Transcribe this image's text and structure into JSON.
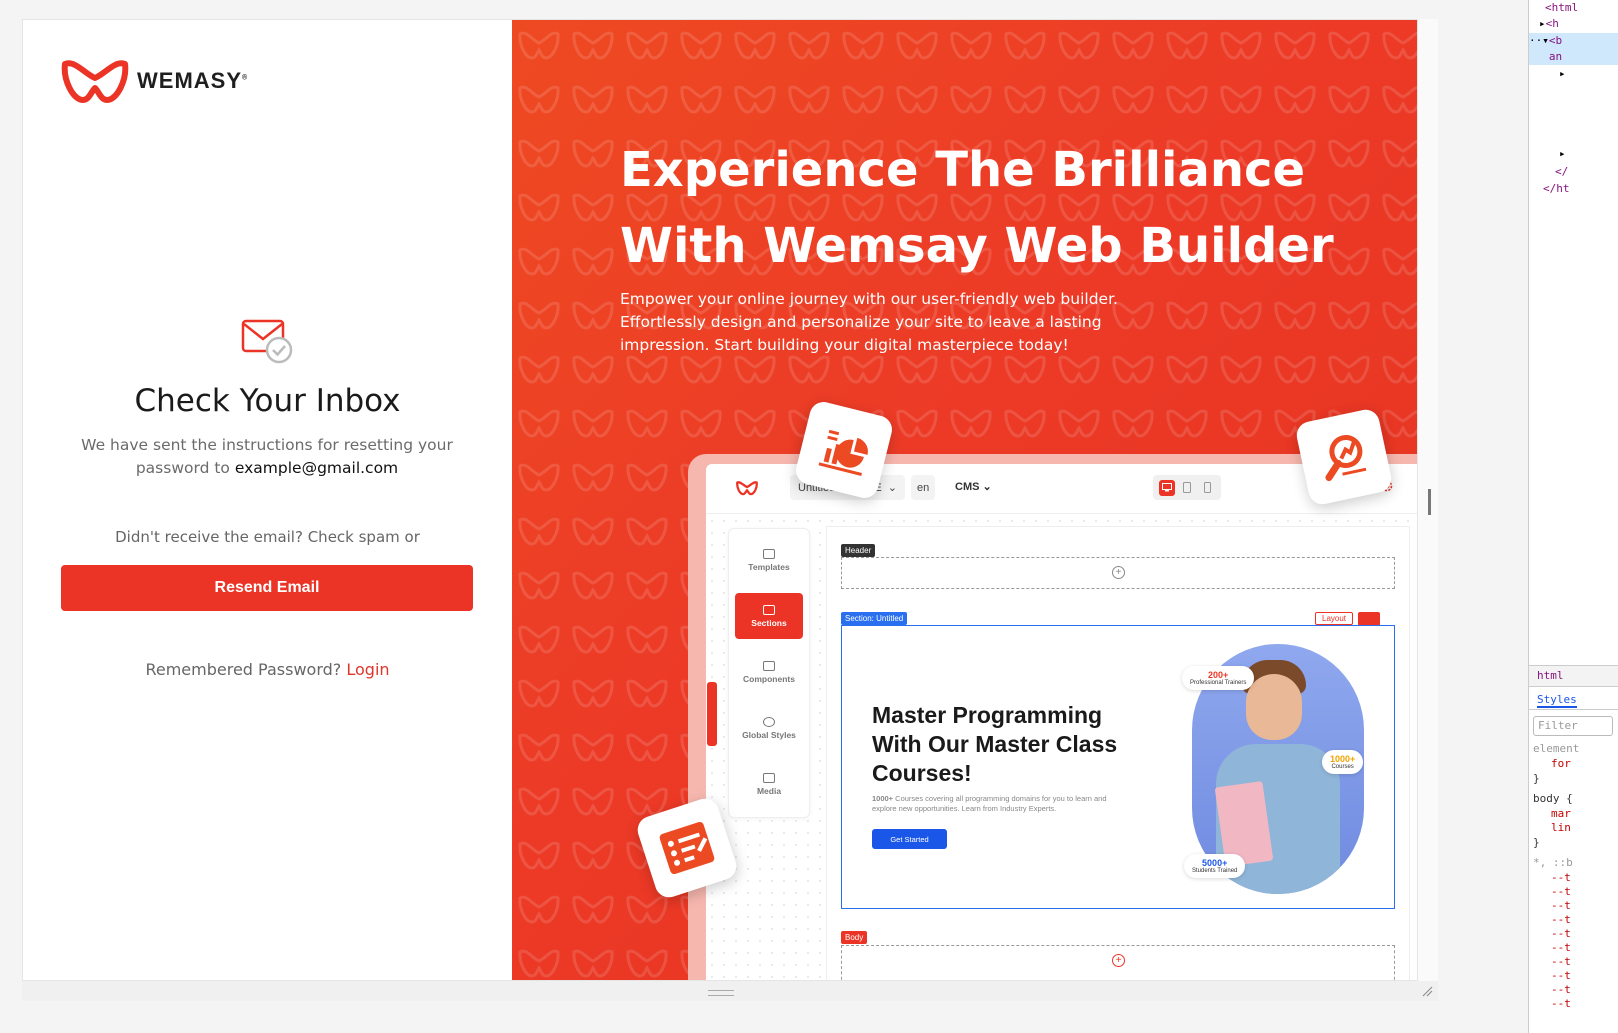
{
  "brand": {
    "name": "WEMASY",
    "reg": "®",
    "accent": "#ec3426"
  },
  "auth": {
    "title": "Check Your Inbox",
    "desc_prefix": "We have sent the instructions for resetting your password to",
    "email": "example@gmail.com",
    "spam_text": "Didn't receive the email? Check spam or",
    "resend_label": "Resend Email",
    "remembered_text": "Remembered Password?",
    "login_label": "Login"
  },
  "hero": {
    "headline_line1": "Experience The Brilliance",
    "headline_line2": "With Wemsay Web Builder",
    "paragraph": "Empower your online journey with our user-friendly web builder. Effortlessly design and personalize your site to leave a lasting impression. Start building your digital masterpiece today!"
  },
  "builder": {
    "site_name": "Untitled W...SITE",
    "lang": "en",
    "cms": "CMS",
    "tools": [
      {
        "label": "Templates",
        "icon": "templates-icon"
      },
      {
        "label": "Sections",
        "icon": "sections-icon",
        "active": true
      },
      {
        "label": "Components",
        "icon": "components-icon"
      },
      {
        "label": "Global Styles",
        "icon": "palette-icon"
      },
      {
        "label": "Media",
        "icon": "image-icon"
      }
    ],
    "tag_header": "Header",
    "tag_section": "Section: Untitled",
    "tag_body": "Body",
    "layout_label": "Layout",
    "section": {
      "heading": "Master Programming With Our Master Class Courses!",
      "para_bold": "1000+",
      "para": "Courses covering all programming domains for you to learn and explore new opportunities. Learn from Industry Experts.",
      "cta": "Get Started",
      "stats": [
        {
          "num": "200+",
          "label": "Professional Trainers",
          "color": "#ec3426"
        },
        {
          "num": "1000+",
          "label": "Courses",
          "color": "#f0a400"
        },
        {
          "num": "5000+",
          "label": "Students Trained",
          "color": "#1a56e8"
        }
      ]
    }
  },
  "devtools": {
    "lines": [
      "<html",
      "<h",
      "<b",
      "an",
      "",
      "",
      "",
      "",
      "",
      "",
      "</",
      "</ht"
    ],
    "tab": "html",
    "styles_label": "Styles",
    "filter_placeholder": "Filter",
    "rule1_sel": "element",
    "rule1_prop": "for",
    "rule2_sel": "body {",
    "rule2_p1": "mar",
    "rule2_p2": "lin",
    "rule3_sel": "*, ::b",
    "var_prefix": "--t"
  }
}
